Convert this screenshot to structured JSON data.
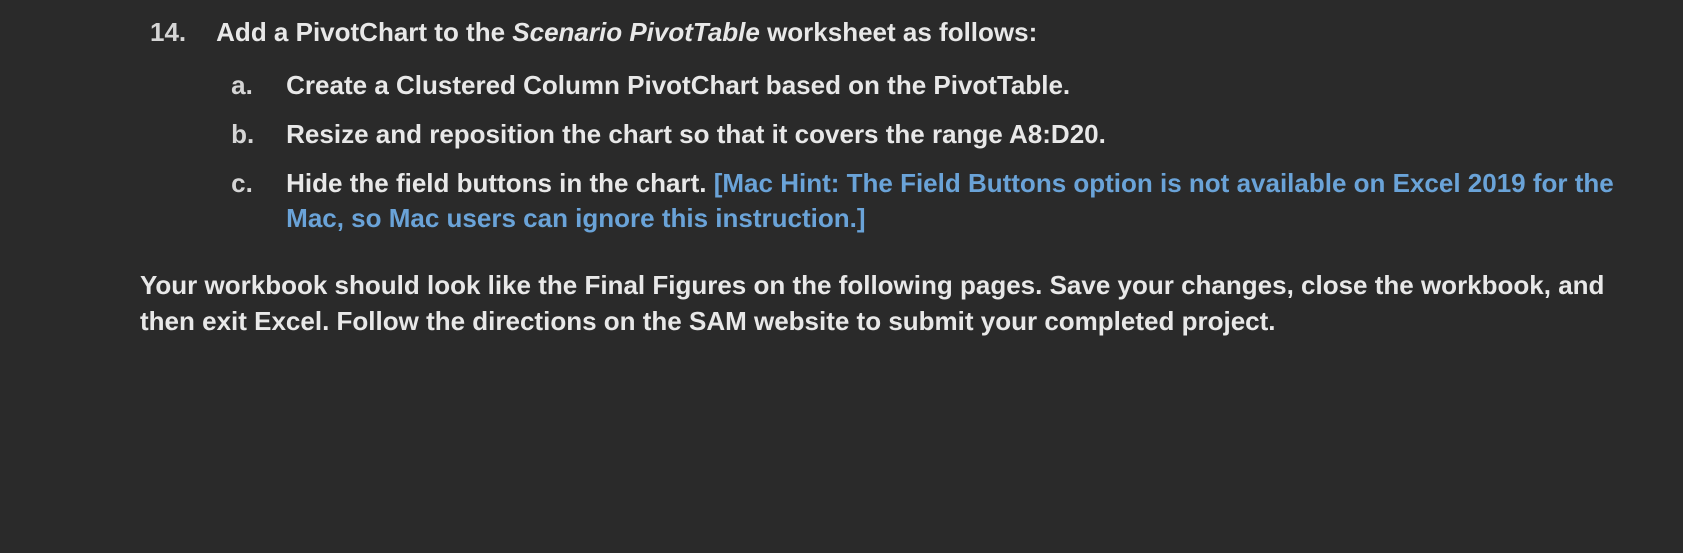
{
  "question": {
    "number": "14.",
    "intro_prefix": "Add a PivotChart to the ",
    "intro_italic": "Scenario PivotTable",
    "intro_suffix": " worksheet as follows:",
    "items": [
      {
        "marker": "a.",
        "text": "Create a Clustered Column PivotChart based on the PivotTable."
      },
      {
        "marker": "b.",
        "text": "Resize and reposition the chart so that it covers the range A8:D20."
      },
      {
        "marker": "c.",
        "text_main": "Hide the field buttons in the chart. ",
        "hint": "[Mac Hint: The Field Buttons option is not available on Excel 2019 for the Mac, so Mac users can ignore this instruction.]"
      }
    ]
  },
  "closing_text": "Your workbook should look like the Final Figures on the following pages. Save your changes, close the workbook, and then exit Excel. Follow the directions on the SAM website to submit your completed project."
}
